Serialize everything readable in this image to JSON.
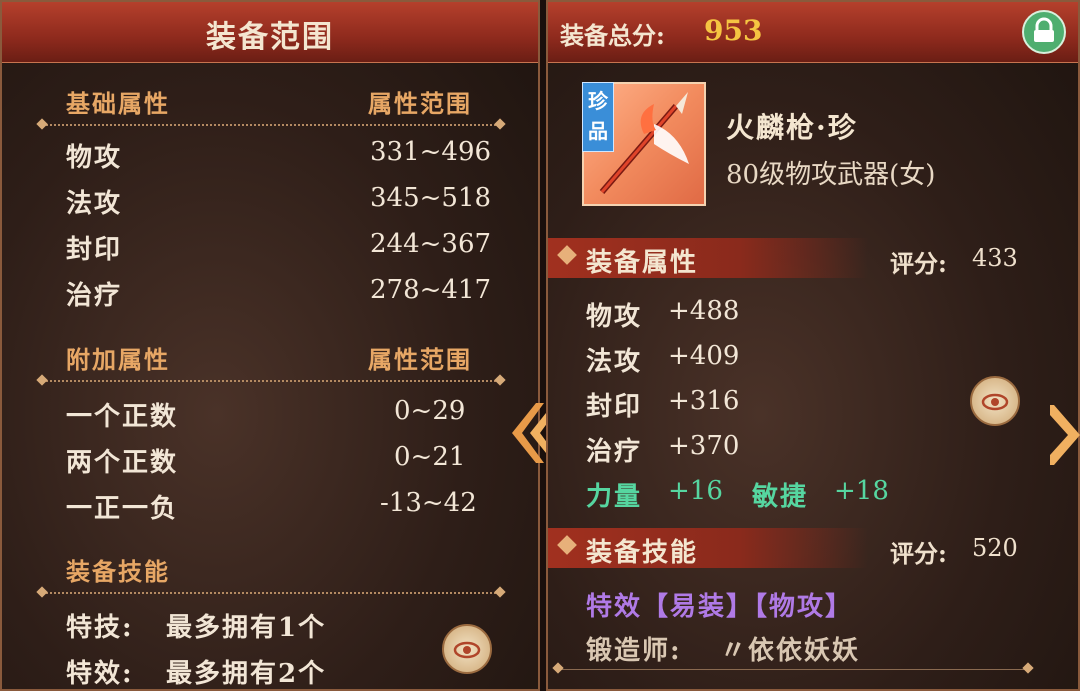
{
  "left": {
    "title": "装备范围",
    "base_section": {
      "label": "基础属性",
      "range_header": "属性范围",
      "rows": [
        {
          "name": "物攻",
          "range": "331~496"
        },
        {
          "name": "法攻",
          "range": "345~518"
        },
        {
          "name": "封印",
          "range": "244~367"
        },
        {
          "name": "治疗",
          "range": "278~417"
        }
      ]
    },
    "extra_section": {
      "label": "附加属性",
      "range_header": "属性范围",
      "rows": [
        {
          "name": "一个正数",
          "range": "0~29"
        },
        {
          "name": "两个正数",
          "range": "0~21"
        },
        {
          "name": "一正一负",
          "range": "-13~42"
        }
      ]
    },
    "skill_section": {
      "label": "装备技能",
      "rows": [
        {
          "name": "特技:",
          "value": "最多拥有1个"
        },
        {
          "name": "特效:",
          "value": "最多拥有2个"
        }
      ]
    }
  },
  "right": {
    "total_label": "装备总分:",
    "total_value": "953",
    "item": {
      "badge": "珍品",
      "name": "火麟枪·珍",
      "desc": "80级物攻武器(女)"
    },
    "attr_section": {
      "label": "装备属性",
      "score_label": "评分:",
      "score": "433",
      "rows": [
        {
          "name": "物攻",
          "value": "+488"
        },
        {
          "name": "法攻",
          "value": "+409"
        },
        {
          "name": "封印",
          "value": "+316"
        },
        {
          "name": "治疗",
          "value": "+370"
        }
      ],
      "bonus": [
        {
          "name": "力量",
          "value": "+16"
        },
        {
          "name": "敏捷",
          "value": "+18"
        }
      ]
    },
    "skill_section": {
      "label": "装备技能",
      "score_label": "评分:",
      "score": "520",
      "effect_text": "特效【易装】【物攻】",
      "forger_label": "锻造师:",
      "forger_name": "〃依依妖妖"
    }
  },
  "colors": {
    "header_red": "#8e2a1d",
    "section_orange": "#e7a765",
    "bonus_green": "#56d6a0",
    "effect_purple": "#b07ae6",
    "score_gold": "#f5c542"
  },
  "icons": [
    "eye-icon",
    "lock-icon",
    "chevron-left-icon",
    "chevron-right-icon"
  ]
}
